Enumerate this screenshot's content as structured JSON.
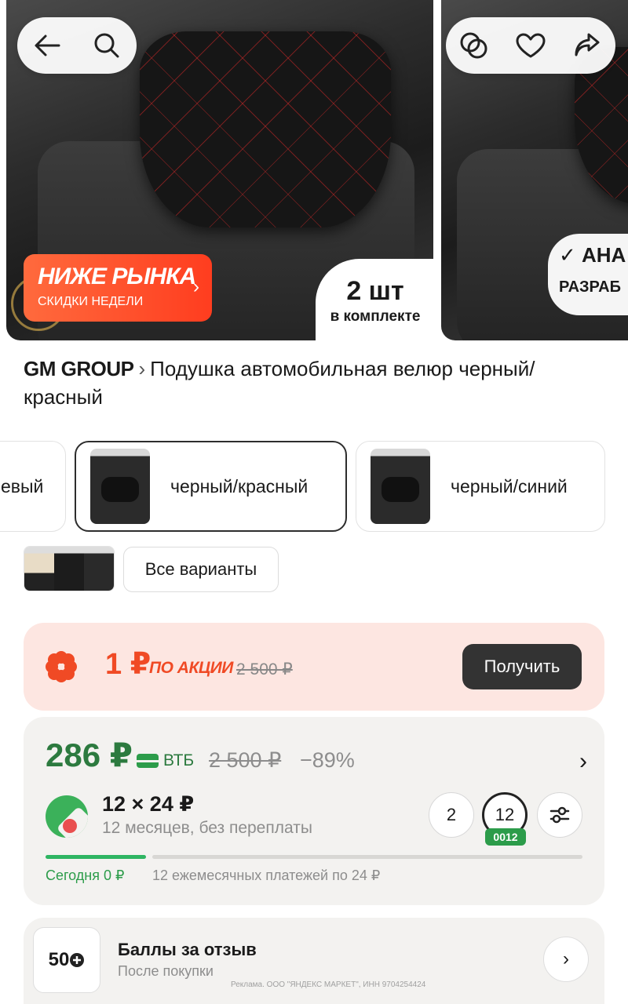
{
  "gallery": {
    "promo_badge": {
      "title": "НИЖЕ РЫНКА",
      "subtitle": "СКИДКИ НЕДЕЛИ",
      "chevron": "›"
    },
    "set_badge": {
      "count": "2 шт",
      "subtitle": "в комплекте"
    },
    "next_photo_badge": {
      "line1": "✓ АНА",
      "line2": "РАЗРАБ"
    },
    "icons": [
      "back-arrow-icon",
      "search-icon",
      "compare-icon",
      "heart-icon",
      "share-icon"
    ]
  },
  "product": {
    "brand": "GM GROUP",
    "brand_chevron": "›",
    "title": "Подушка автомобильная велюр черный/красный"
  },
  "variants": {
    "items": [
      {
        "label": "евый",
        "selected": false
      },
      {
        "label": "черный/красный",
        "selected": true
      },
      {
        "label": "черный/синий",
        "selected": false
      }
    ],
    "all_label": "Все варианты"
  },
  "promo_price": {
    "price": "1 ₽",
    "tag": "ПО АКЦИИ",
    "old_price": "2 500 ₽",
    "button": "Получить"
  },
  "price": {
    "current": "286 ₽",
    "bank": "ВТБ",
    "old": "2 500 ₽",
    "discount": "−89%",
    "chevron": "›",
    "split": {
      "amount": "12 × 24 ₽",
      "description": "12 месяцев, без переплаты",
      "options": [
        "2",
        "12"
      ],
      "selected_chip": "0012",
      "today": "Сегодня 0 ₽",
      "payments": "12 ежемесячных платежей по 24 ₽"
    }
  },
  "review": {
    "points": "50",
    "title": "Баллы за отзыв",
    "subtitle": "После покупки",
    "chevron": "›"
  },
  "ad_notice": "Реклама. ООО \"ЯНДЕКС МАРКЕТ\", ИНН 9704254424",
  "colors": {
    "accent_green": "#2c7a3f",
    "promo_red": "#f04a25",
    "promo_bg": "#fde6e1",
    "card_bg": "#f3f2f0"
  }
}
